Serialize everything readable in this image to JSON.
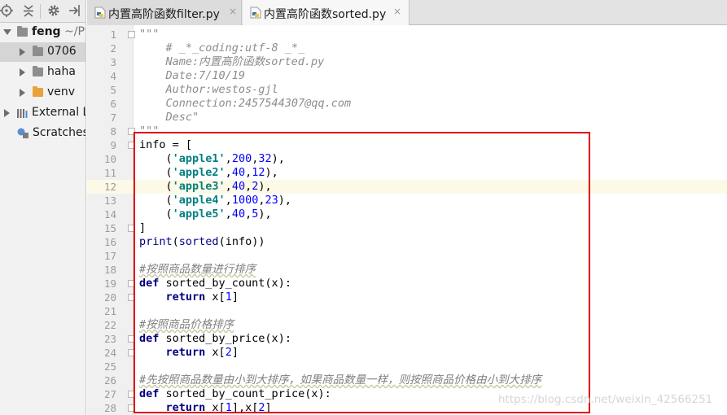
{
  "sidebar": {
    "toolbar_icons": [
      "target-icon",
      "collapse-icon",
      "gear-icon",
      "hide-icon"
    ],
    "tree": [
      {
        "label": "feng",
        "hint": " ~/Py"
      },
      {
        "label": "0706"
      },
      {
        "label": "haha"
      },
      {
        "label": "venv"
      },
      {
        "label": "External L"
      },
      {
        "label": "Scratches"
      }
    ]
  },
  "tabs": [
    {
      "title": "内置高阶函数filter.py",
      "close": "×",
      "active": false
    },
    {
      "title": "内置高阶函数sorted.py",
      "close": "×",
      "active": true
    }
  ],
  "editor": {
    "current_line": 12,
    "lines": [
      {
        "n": "1",
        "code": "\"\"\""
      },
      {
        "n": "2",
        "code": "    # _*_coding:utf-8 _*_"
      },
      {
        "n": "3",
        "code": "    Name:内置高阶函数sorted.py"
      },
      {
        "n": "4",
        "code": "    Date:7/10/19"
      },
      {
        "n": "5",
        "code": "    Author:westos-gjl"
      },
      {
        "n": "6",
        "code": "    Connection:2457544307@qq.com"
      },
      {
        "n": "7",
        "code": "    Desc\""
      },
      {
        "n": "8",
        "code": "\"\"\""
      },
      {
        "n": "9",
        "code": "info = ["
      },
      {
        "n": "10",
        "code": "    ('apple1',200,32),"
      },
      {
        "n": "11",
        "code": "    ('apple2',40,12),"
      },
      {
        "n": "12",
        "code": "    ('apple3',40,2),"
      },
      {
        "n": "13",
        "code": "    ('apple4',1000,23),"
      },
      {
        "n": "14",
        "code": "    ('apple5',40,5),"
      },
      {
        "n": "15",
        "code": "]"
      },
      {
        "n": "16",
        "code": "print(sorted(info))"
      },
      {
        "n": "17",
        "code": ""
      },
      {
        "n": "18",
        "code": "#按照商品数量进行排序"
      },
      {
        "n": "19",
        "code": "def sorted_by_count(x):"
      },
      {
        "n": "20",
        "code": "    return x[1]"
      },
      {
        "n": "21",
        "code": ""
      },
      {
        "n": "22",
        "code": "#按照商品价格排序"
      },
      {
        "n": "23",
        "code": "def sorted_by_price(x):"
      },
      {
        "n": "24",
        "code": "    return x[2]"
      },
      {
        "n": "25",
        "code": ""
      },
      {
        "n": "26",
        "code": "#先按照商品数量由小到大排序，如果商品数量一样，则按照商品价格由小到大排序"
      },
      {
        "n": "27",
        "code": "def sorted_by_count_price(x):"
      },
      {
        "n": "28",
        "code": "    return x[1],x[2]"
      }
    ]
  },
  "watermark": "https://blog.csdn.net/weixin_42566251",
  "colors": {
    "highlight_box": "#e00000",
    "keyword": "#000080",
    "string": "#008080",
    "number": "#0000ff",
    "folder_orange": "#e9a23b",
    "folder_gray": "#8e8e8e"
  }
}
